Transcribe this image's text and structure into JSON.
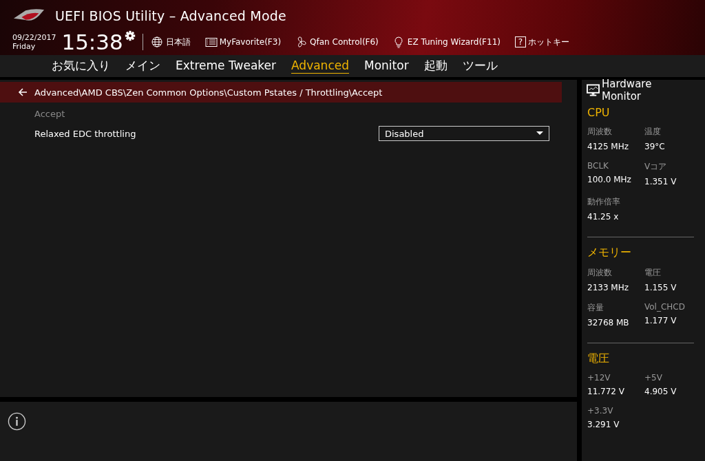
{
  "header": {
    "title": "UEFI BIOS Utility – Advanced Mode",
    "date": "09/22/2017",
    "day": "Friday",
    "time": "15:38",
    "tools": [
      {
        "kind": "globe",
        "label": "日本語"
      },
      {
        "kind": "list",
        "label": "MyFavorite(F3)"
      },
      {
        "kind": "fan",
        "label": "Qfan Control(F6)"
      },
      {
        "kind": "bulb",
        "label": "EZ Tuning Wizard(F11)"
      },
      {
        "kind": "help",
        "icon_text": "?",
        "label": "ホットキー"
      }
    ]
  },
  "tabs": [
    {
      "label": "お気に入り",
      "selected": false
    },
    {
      "label": "メイン",
      "selected": false
    },
    {
      "label": "Extreme Tweaker",
      "selected": false
    },
    {
      "label": "Advanced",
      "selected": true
    },
    {
      "label": "Monitor",
      "selected": false
    },
    {
      "label": "起動",
      "selected": false
    },
    {
      "label": "ツール",
      "selected": false
    }
  ],
  "breadcrumb": "Advanced\\AMD CBS\\Zen Common Options\\Custom Pstates / Throttling\\Accept",
  "section_label": "Accept",
  "settings": [
    {
      "label": "Relaxed EDC throttling",
      "value": "Disabled"
    }
  ],
  "hardware_monitor": {
    "title": "Hardware Monitor",
    "sections": [
      {
        "title": "CPU",
        "items": [
          {
            "label": "周波数",
            "value": "4125 MHz"
          },
          {
            "label": "温度",
            "value": "39°C"
          },
          {
            "label": "BCLK",
            "value": "100.0 MHz"
          },
          {
            "label": "Vコア",
            "value": "1.351 V"
          },
          {
            "label": "動作倍率",
            "value": "41.25 x"
          }
        ]
      },
      {
        "title": "メモリー",
        "items": [
          {
            "label": "周波数",
            "value": "2133 MHz"
          },
          {
            "label": "電圧",
            "value": "1.155 V"
          },
          {
            "label": "容量",
            "value": "32768 MB"
          },
          {
            "label": "Vol_CHCD",
            "value": "1.177 V"
          }
        ]
      },
      {
        "title": "電圧",
        "items": [
          {
            "label": "+12V",
            "value": "11.772 V"
          },
          {
            "label": "+5V",
            "value": "4.905 V"
          },
          {
            "label": "+3.3V",
            "value": "3.291 V"
          }
        ]
      }
    ]
  }
}
